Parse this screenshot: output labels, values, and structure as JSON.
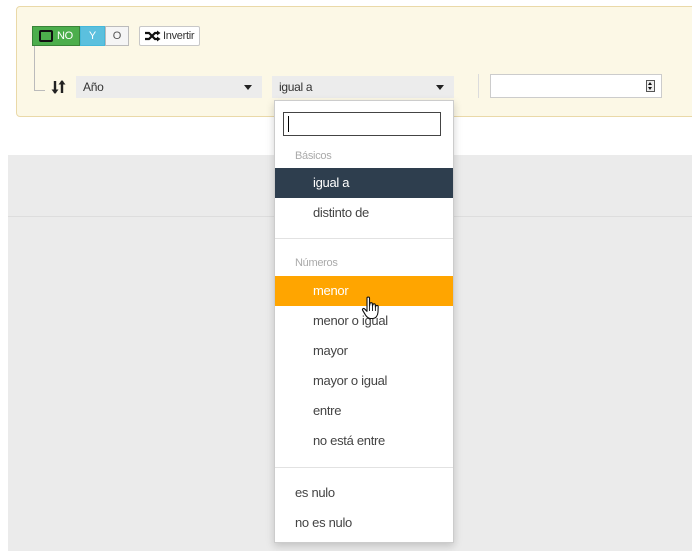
{
  "toolbar": {
    "no_label": "NO",
    "y_label": "Y",
    "o_label": "O",
    "invert_label": "Invertir"
  },
  "rule": {
    "field_value": "Año",
    "operator_value": "igual a",
    "value": ""
  },
  "dropdown": {
    "search_value": "",
    "groups": {
      "basic_header": "Básicos",
      "numbers_header": "Números"
    },
    "items": [
      "igual a",
      "distinto de",
      "menor",
      "menor o igual",
      "mayor",
      "mayor o igual",
      "entre",
      "no está entre",
      "es nulo",
      "no es nulo"
    ],
    "selected_item": "igual a",
    "hovered_item": "menor"
  },
  "colors": {
    "no_button": "#4cae4c",
    "y_button": "#5bc0de",
    "selected_bg": "#2e3e4e",
    "hover_bg": "#ffa500",
    "panel_bg": "#fcf8e6"
  },
  "icons": {
    "invert": "shuffle-icon",
    "sort": "sort-arrows-icon",
    "spinner": "spinner-icon",
    "cursor": "hand-pointer-icon"
  }
}
